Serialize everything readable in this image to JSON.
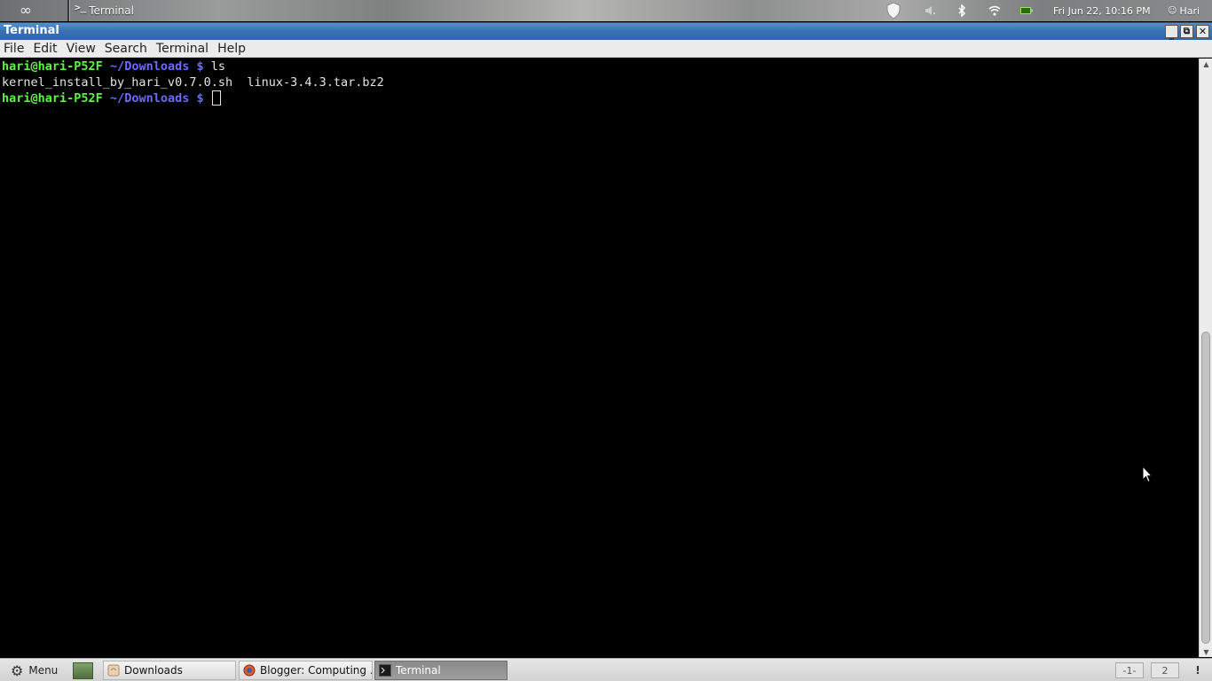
{
  "top_panel": {
    "app_menu_icon": "infinity-icon",
    "active_window_label": "Terminal",
    "active_window_icon_glyph": ">_",
    "tray_icons": [
      "shield-icon",
      "volume-icon",
      "bluetooth-icon",
      "wifi-icon",
      "battery-icon"
    ],
    "clock": "Fri Jun 22, 10:16 PM",
    "user": "Hari"
  },
  "window": {
    "title": "Terminal",
    "controls": [
      "minimize",
      "maximize",
      "close"
    ]
  },
  "menubar": {
    "items": [
      "File",
      "Edit",
      "View",
      "Search",
      "Terminal",
      "Help"
    ]
  },
  "terminal": {
    "lines": [
      {
        "user_host": "hari@hari-P52F",
        "path": "~/Downloads",
        "symbol": "$",
        "command": "ls"
      },
      {
        "output": "kernel_install_by_hari_v0.7.0.sh  linux-3.4.3.tar.bz2"
      },
      {
        "user_host": "hari@hari-P52F",
        "path": "~/Downloads",
        "symbol": "$",
        "command": ""
      }
    ]
  },
  "taskbar": {
    "menu_label": "Menu",
    "tasks": [
      {
        "label": "Downloads",
        "icon": "folder-icon"
      },
      {
        "label": "Blogger: Computing ...",
        "icon": "browser-icon"
      },
      {
        "label": "Terminal",
        "icon": "terminal-icon",
        "active": true
      }
    ],
    "workspaces": [
      "-1-",
      "2"
    ],
    "notify_label": "!"
  },
  "colors": {
    "prompt_user": "#5ff545",
    "prompt_path": "#6b6bff",
    "titlebar": "#3a73b5",
    "terminal_bg": "#000000"
  }
}
